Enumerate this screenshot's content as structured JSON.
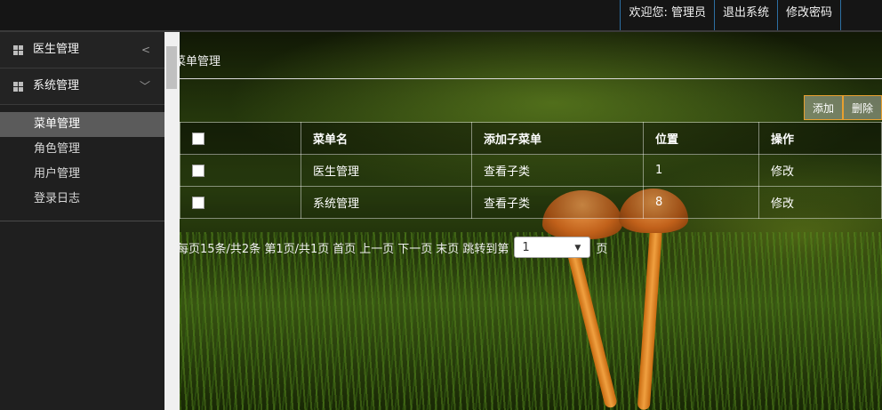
{
  "header": {
    "welcome": "欢迎您: 管理员",
    "logout": "退出系统",
    "change_password": "修改密码"
  },
  "sidebar": {
    "groups": [
      {
        "label": "医生管理",
        "chevron": "<",
        "expanded": false
      },
      {
        "label": "系统管理",
        "chevron": "﹀",
        "expanded": true
      }
    ],
    "items": [
      {
        "label": "菜单管理",
        "active": true
      },
      {
        "label": "角色管理",
        "active": false
      },
      {
        "label": "用户管理",
        "active": false
      },
      {
        "label": "登录日志",
        "active": false
      }
    ]
  },
  "main": {
    "breadcrumb": "菜单管理",
    "buttons": {
      "add": "添加",
      "delete": "删除"
    },
    "table": {
      "headers": [
        "菜单名",
        "添加子菜单",
        "位置",
        "操作"
      ],
      "rows": [
        {
          "name": "医生管理",
          "sub": "查看子类",
          "pos": "1",
          "op": "修改"
        },
        {
          "name": "系统管理",
          "sub": "查看子类",
          "pos": "8",
          "op": "修改"
        }
      ]
    },
    "pager": {
      "summary": "每页15条/共2条 第1页/共1页",
      "first": "首页",
      "prev": "上一页",
      "next": "下一页",
      "last": "末页",
      "jump": "跳转到第",
      "selected": "1",
      "suffix": "页"
    }
  },
  "colors": {
    "accent_border": "#2d6fa3",
    "button_border": "#e8a030"
  }
}
